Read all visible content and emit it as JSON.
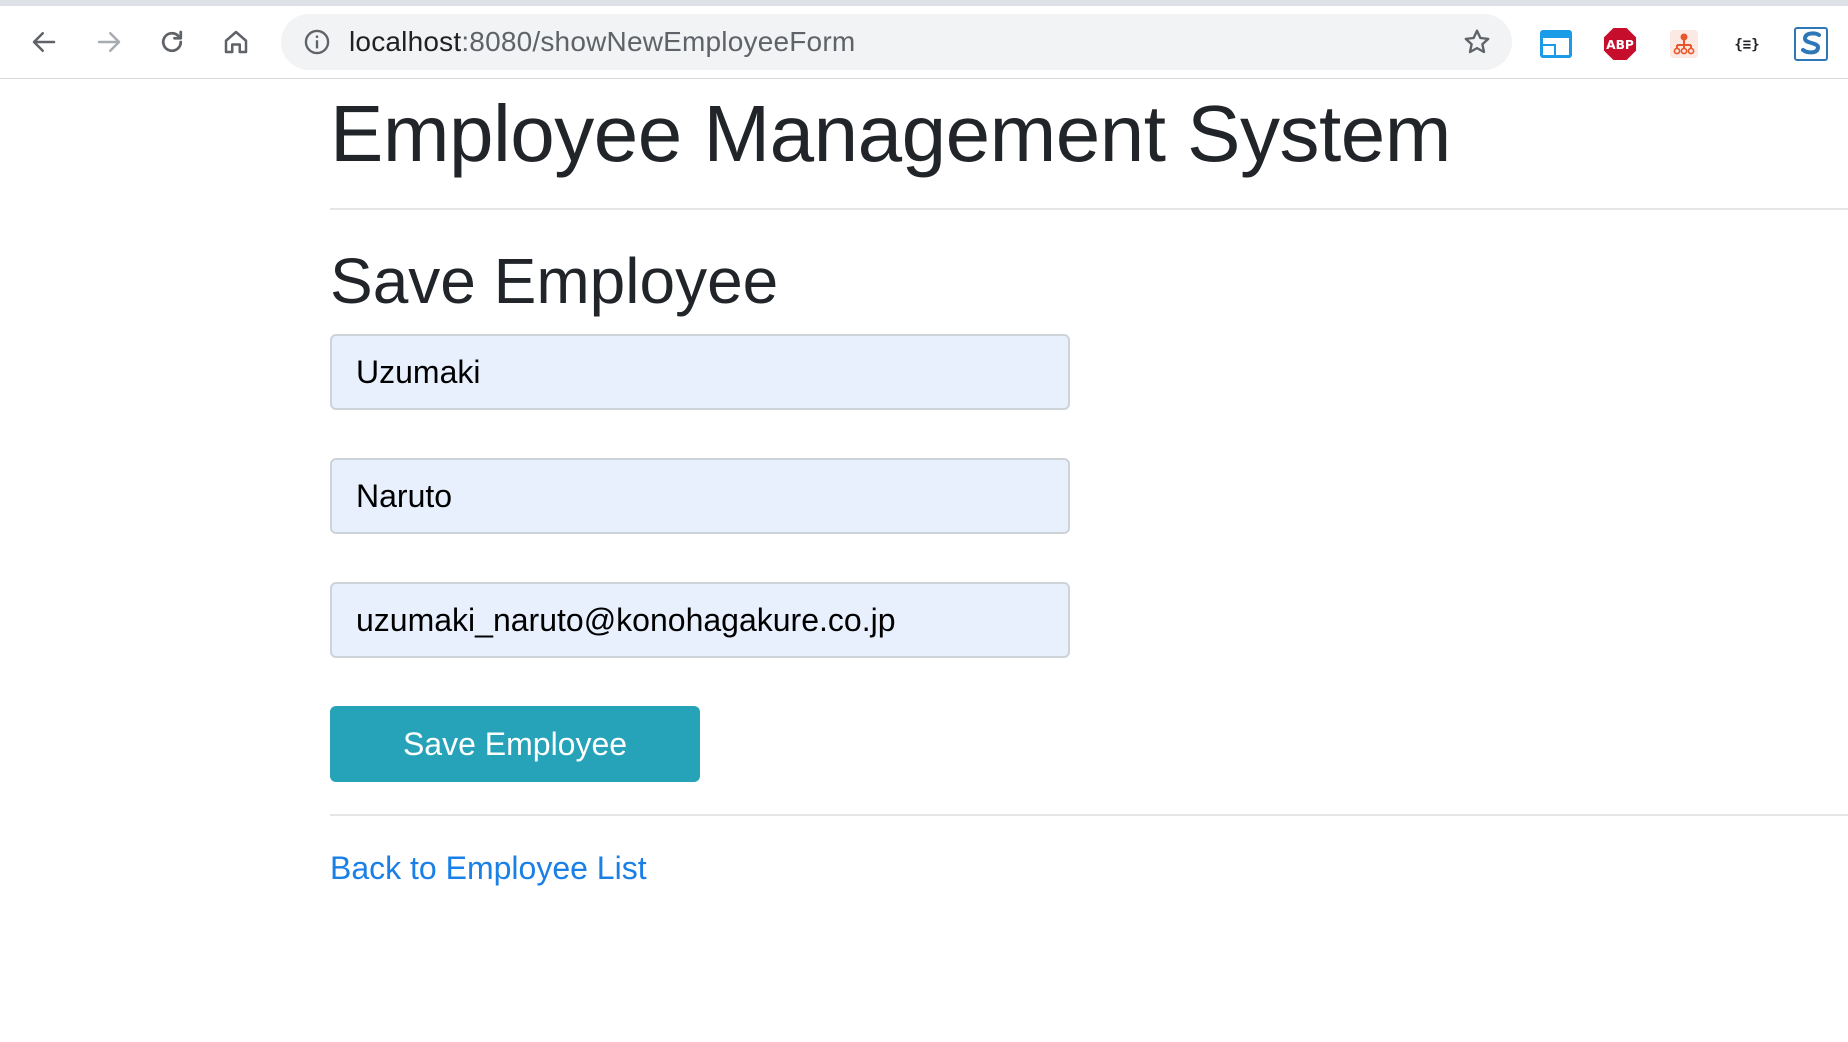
{
  "browser": {
    "url_host": "localhost",
    "url_rest": ":8080/showNewEmployeeForm",
    "extensions": [
      {
        "name": "window-extension-icon",
        "color": "#1a9be8"
      },
      {
        "name": "adblock-plus-icon",
        "label": "ABP",
        "color": "#c70d2c"
      },
      {
        "name": "sitemap-extension-icon",
        "color": "#e8562a"
      },
      {
        "name": "json-formatter-icon",
        "label": "{≡}"
      },
      {
        "name": "s-extension-icon",
        "label": "S",
        "color": "#2f78b7"
      }
    ]
  },
  "page": {
    "title": "Employee Management System",
    "form_title": "Save Employee",
    "fields": {
      "first_name": "Uzumaki",
      "last_name": "Naruto",
      "email": "uzumaki_naruto@konohagakure.co.jp"
    },
    "save_label": "Save Employee",
    "back_link": "Back to Employee List"
  },
  "colors": {
    "field_bg": "#e8f0fe",
    "button_bg": "#26a3b8",
    "link": "#1a7fe6"
  }
}
